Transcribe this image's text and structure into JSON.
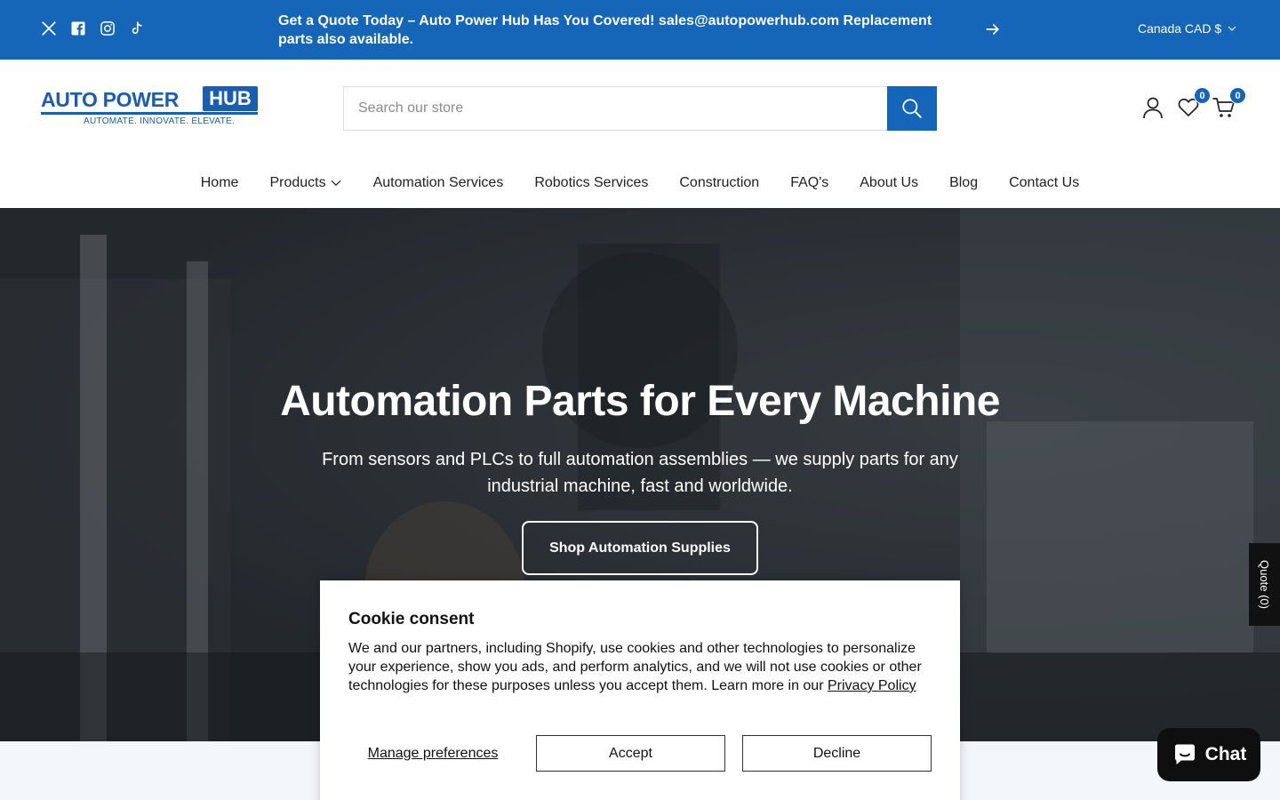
{
  "topbar": {
    "announcement": "Get a Quote Today – Auto Power Hub Has You Covered! sales@autopowerhub.com Replacement parts also available.",
    "currency": "Canada CAD $",
    "social_icons": [
      "x-icon",
      "facebook-icon",
      "instagram-icon",
      "tiktok-icon"
    ]
  },
  "logo": {
    "main": "AUTO POWER",
    "hub": "HUB",
    "tagline": "AUTOMATE. INNOVATE. ELEVATE."
  },
  "search": {
    "placeholder": "Search our store"
  },
  "header": {
    "wishlist_count": "0",
    "cart_count": "0"
  },
  "nav": {
    "items": [
      "Home",
      "Products",
      "Automation Services",
      "Robotics Services",
      "Construction",
      "FAQ's",
      "About Us",
      "Blog",
      "Contact Us"
    ]
  },
  "hero": {
    "title": "Automation Parts for Every Machine",
    "subtitle": "From sensors and PLCs to full automation assemblies — we supply parts for any industrial machine, fast and worldwide.",
    "cta": "Shop Automation Supplies"
  },
  "quote_tab": {
    "label": "Quote (0)"
  },
  "cookie": {
    "title": "Cookie consent",
    "body": "We and our partners, including Shopify, use cookies and other technologies to personalize your experience, show you ads, and perform analytics, and we will not use cookies or other technologies for these purposes unless you accept them. Learn more in our ",
    "link": "Privacy Policy",
    "manage": "Manage preferences",
    "accept": "Accept",
    "decline": "Decline"
  },
  "chat": {
    "label": "Chat"
  },
  "colors": {
    "brand_blue": "#1565b8",
    "dark": "#0f0f0f"
  }
}
